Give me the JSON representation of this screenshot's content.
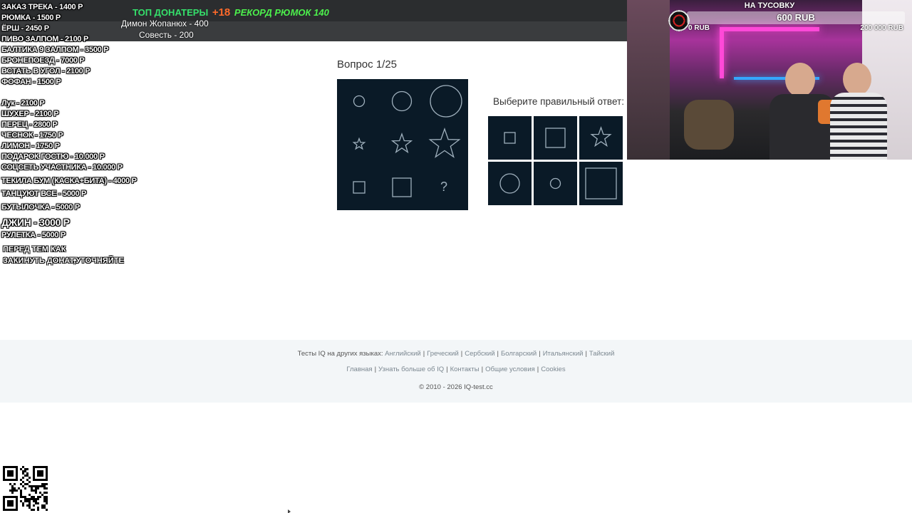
{
  "overlay_pricelist": {
    "items": [
      "ЗАКАЗ ТРЕКА - 1400 Р",
      "РЮМКА - 1500 Р",
      "ЁРШ - 2450 Р",
      "ПИВО ЗАЛПОМ - 2100 Р",
      "БАЛТИКА 9 ЗАЛПОМ - 3500 Р",
      "БРОНЕПОЕЗД - 7000 Р",
      "ВСТАТЬ В УГОЛ - 2100 Р",
      "ФОФАН - 1500 Р",
      "Лук - 2100 Р",
      "ШУХЕР - 2100 Р",
      "ПЕРЕЦ - 2800 Р",
      "ЧЕСНОК - 1750 Р",
      "ЛИМОН - 1750 Р",
      "ПОДАРОК ГОСТЮ - 10.000 Р",
      "СОЦСЕТЬ УЧАСТНИКА - 10.000 Р",
      "ТЕКИЛА БУМ (КАСКА+БИТА) - 4000 Р",
      "ТАНЦУЮТ ВСЕ - 5000 Р",
      "БУТЫЛОЧКА - 5000 Р",
      "ДЖИН - 3000 Р",
      "РУЛЕТКА - 5000 Р"
    ],
    "note_line1": "ПЕРЕД ТЕМ КАК",
    "note_line2": "ЗАКИНУТЬ ДОНАТ,УТОЧНЯЙТЕ"
  },
  "overlay_donors": {
    "title": "ТОП ДОНАТЕРЫ",
    "age": "+18",
    "record": "РЕКОРД РЮМОК 140",
    "entries": [
      "Димон Жопанюх - 400",
      "Совесть - 200"
    ]
  },
  "overlay_goal": {
    "title": "НА ТУСОВКУ",
    "current": "600 RUB",
    "min": "0 RUB",
    "max": "200 000 RUB",
    "progress_fraction": 0.003
  },
  "quiz": {
    "question_label": "Вопрос 1/25",
    "answers_prompt": "Выберите правильный ответ:",
    "matrix_cells": [
      "small-circle",
      "medium-circle",
      "large-circle",
      "small-star",
      "medium-star",
      "large-star",
      "small-square",
      "medium-square",
      "?"
    ],
    "answer_options": [
      "small-square",
      "medium-square",
      "medium-star",
      "medium-circle",
      "small-circle",
      "large-square"
    ]
  },
  "footer": {
    "languages_label": "Тесты IQ на других языках:",
    "languages": [
      "Английский",
      "Греческий",
      "Сербский",
      "Болгарский",
      "Итальянский",
      "Тайский"
    ],
    "links": [
      "Главная",
      "Узнать больше об IQ",
      "Контакты",
      "Общие условия",
      "Cookies"
    ],
    "copyright": "© 2010 - 2026 IQ-test.cc"
  },
  "colors": {
    "tile_bg": "#0a1a27",
    "shape_stroke": "#9fb0bd",
    "header_bg": "#2b2d2f",
    "footer_bg": "#f3f6f8",
    "link": "#7c8891"
  }
}
